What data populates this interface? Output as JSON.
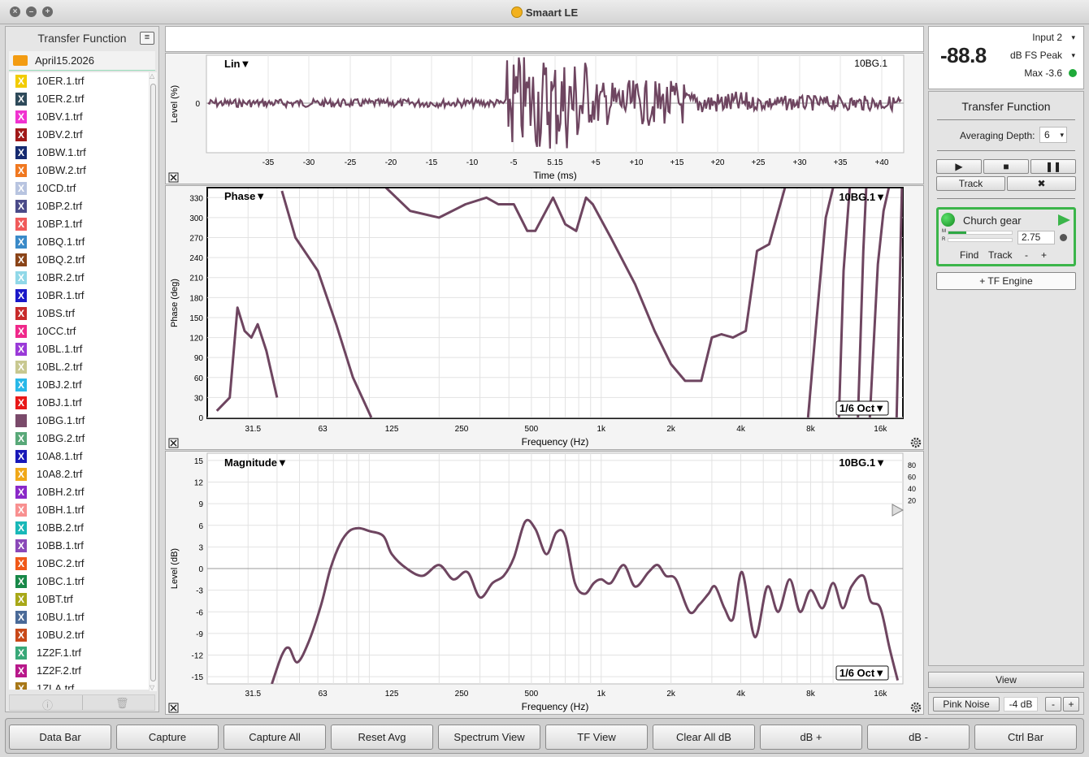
{
  "app": {
    "title": "Smaart LE"
  },
  "left_panel": {
    "title": "Transfer Function",
    "folder": "April15.2026",
    "files": [
      {
        "name": "10ER.1.trf",
        "color": "#f2cc00"
      },
      {
        "name": "10ER.2.trf",
        "color": "#2e4a5a"
      },
      {
        "name": "10BV.1.trf",
        "color": "#f032d0"
      },
      {
        "name": "10BV.2.trf",
        "color": "#a01818"
      },
      {
        "name": "10BW.1.trf",
        "color": "#152a70"
      },
      {
        "name": "10BW.2.trf",
        "color": "#f07820"
      },
      {
        "name": "10CD.trf",
        "color": "#b8c4e0"
      },
      {
        "name": "10BP.2.trf",
        "color": "#4a4a88"
      },
      {
        "name": "10BP.1.trf",
        "color": "#f05a5a"
      },
      {
        "name": "10BQ.1.trf",
        "color": "#3a8ac8"
      },
      {
        "name": "10BQ.2.trf",
        "color": "#8a4418"
      },
      {
        "name": "10BR.2.trf",
        "color": "#90d8e8"
      },
      {
        "name": "10BR.1.trf",
        "color": "#1a18c8"
      },
      {
        "name": "10BS.trf",
        "color": "#c82a2a"
      },
      {
        "name": "10CC.trf",
        "color": "#f0288a"
      },
      {
        "name": "10BL.1.trf",
        "color": "#9a3ad8"
      },
      {
        "name": "10BL.2.trf",
        "color": "#c8c890"
      },
      {
        "name": "10BJ.2.trf",
        "color": "#28b8e8"
      },
      {
        "name": "10BJ.1.trf",
        "color": "#e81818"
      },
      {
        "name": "10BG.1.trf",
        "color": "#7a4a6a"
      },
      {
        "name": "10BG.2.trf",
        "color": "#58a878"
      },
      {
        "name": "10A8.1.trf",
        "color": "#1818b8"
      },
      {
        "name": "10A8.2.trf",
        "color": "#f0a818"
      },
      {
        "name": "10BH.2.trf",
        "color": "#8a28c8"
      },
      {
        "name": "10BH.1.trf",
        "color": "#f89090"
      },
      {
        "name": "10BB.2.trf",
        "color": "#18b8b8"
      },
      {
        "name": "10BB.1.trf",
        "color": "#8a48b8"
      },
      {
        "name": "10BC.2.trf",
        "color": "#f05818"
      },
      {
        "name": "10BC.1.trf",
        "color": "#188848"
      },
      {
        "name": "10BT.trf",
        "color": "#a8a818"
      },
      {
        "name": "10BU.1.trf",
        "color": "#4a6a98"
      },
      {
        "name": "10BU.2.trf",
        "color": "#c84818"
      },
      {
        "name": "1Z2F.1.trf",
        "color": "#38a878"
      },
      {
        "name": "1Z2F.2.trf",
        "color": "#b8188a"
      },
      {
        "name": "1ZLA.trf",
        "color": "#a87818"
      }
    ]
  },
  "meter": {
    "value": "-88.8",
    "input": "Input 2",
    "mode": "dB FS Peak",
    "max": "Max -3.6"
  },
  "tf_panel": {
    "title": "Transfer Function",
    "averaging_label": "Averaging Depth:",
    "averaging_value": "6",
    "track_label": "Track",
    "engine": {
      "name": "Church gear",
      "value": "2.75",
      "find": "Find",
      "track": "Track",
      "minus": "-",
      "plus": "+",
      "m": "M",
      "r": "R"
    },
    "add_engine": "+ TF Engine"
  },
  "view_panel": {
    "view_label": "View",
    "pink_noise": "Pink Noise",
    "level": "-4 dB",
    "minus": "-",
    "plus": "+"
  },
  "toolbar": [
    "Data Bar",
    "Capture",
    "Capture All",
    "Reset Avg",
    "Spectrum View",
    "TF View",
    "Clear All dB",
    "dB +",
    "dB -",
    "Ctrl Bar"
  ],
  "impulse": {
    "label": "Lin▼",
    "trace": "10BG.1",
    "ylabel": "Level (%)",
    "xlabel": "Time (ms)",
    "zero_label": "0",
    "x_ticks": [
      "-35",
      "-30",
      "-25",
      "-20",
      "-15",
      "-10",
      "-5",
      "5.15",
      "+5",
      "+10",
      "+15",
      "+20",
      "+25",
      "+30",
      "+35",
      "+40"
    ]
  },
  "chart_data": [
    {
      "type": "line",
      "title": "Phase▼",
      "trace": "10BG.1▼",
      "ylabel": "Phase (deg)",
      "xlabel": "Frequency (Hz)",
      "smoothing": "1/6 Oct▼",
      "ylim": [
        0,
        345
      ],
      "y_ticks": [
        "330",
        "300",
        "270",
        "240",
        "210",
        "180",
        "150",
        "120",
        "90",
        "60",
        "30",
        "0"
      ],
      "x_ticks": [
        "31.5",
        "63",
        "125",
        "250",
        "500",
        "1k",
        "2k",
        "4k",
        "8k",
        "16k"
      ],
      "series": [
        {
          "color": "#6e4560",
          "segments": [
            [
              [
                22,
                10
              ],
              [
                25,
                30
              ],
              [
                27,
                165
              ],
              [
                29,
                130
              ],
              [
                31,
                120
              ],
              [
                33,
                140
              ],
              [
                36,
                100
              ],
              [
                40,
                30
              ]
            ],
            [
              [
                42,
                340
              ],
              [
                48,
                270
              ],
              [
                60,
                220
              ],
              [
                72,
                140
              ],
              [
                85,
                60
              ],
              [
                102,
                0
              ]
            ],
            [
              [
                118,
                345
              ],
              [
                150,
                310
              ],
              [
                200,
                300
              ],
              [
                260,
                320
              ],
              [
                320,
                330
              ],
              [
                360,
                320
              ],
              [
                420,
                320
              ],
              [
                480,
                280
              ],
              [
                520,
                280
              ],
              [
                620,
                330
              ],
              [
                700,
                290
              ],
              [
                780,
                280
              ],
              [
                860,
                330
              ],
              [
                920,
                320
              ],
              [
                1100,
                270
              ],
              [
                1400,
                200
              ],
              [
                1700,
                130
              ],
              [
                2000,
                80
              ],
              [
                2300,
                55
              ],
              [
                2700,
                55
              ],
              [
                3000,
                120
              ],
              [
                3300,
                125
              ],
              [
                3700,
                120
              ],
              [
                4200,
                130
              ],
              [
                4700,
                250
              ],
              [
                5300,
                260
              ],
              [
                6200,
                345
              ]
            ],
            [
              [
                7800,
                0
              ],
              [
                8500,
                150
              ],
              [
                9300,
                300
              ],
              [
                10000,
                345
              ]
            ],
            [
              [
                10600,
                0
              ],
              [
                11100,
                220
              ],
              [
                11800,
                345
              ]
            ],
            [
              [
                12800,
                0
              ],
              [
                13500,
                250
              ],
              [
                13900,
                345
              ]
            ],
            [
              [
                14400,
                0
              ],
              [
                15600,
                230
              ],
              [
                16500,
                310
              ],
              [
                17400,
                345
              ]
            ],
            [
              [
                18800,
                0
              ],
              [
                19800,
                345
              ]
            ]
          ]
        }
      ]
    },
    {
      "type": "line",
      "title": "Magnitude▼",
      "trace": "10BG.1▼",
      "ylabel": "Level (dB)",
      "xlabel": "Frequency (Hz)",
      "smoothing": "1/6 Oct▼",
      "ylim": [
        -16,
        16
      ],
      "y_ticks": [
        "15",
        "12",
        "9",
        "6",
        "3",
        "0",
        "-3",
        "-6",
        "-9",
        "-12",
        "-15"
      ],
      "x_ticks": [
        "31.5",
        "63",
        "125",
        "250",
        "500",
        "1k",
        "2k",
        "4k",
        "8k",
        "16k"
      ],
      "coherence_ticks": [
        "80",
        "60",
        "40",
        "20"
      ],
      "series": [
        {
          "color": "#6e4560",
          "values": [
            [
              38,
              -16
            ],
            [
              42,
              -12
            ],
            [
              45,
              -11
            ],
            [
              49,
              -13
            ],
            [
              55,
              -10
            ],
            [
              62,
              -5
            ],
            [
              68,
              0
            ],
            [
              75,
              3.5
            ],
            [
              82,
              5.2
            ],
            [
              90,
              5.6
            ],
            [
              100,
              5.2
            ],
            [
              115,
              4.5
            ],
            [
              125,
              2
            ],
            [
              145,
              0
            ],
            [
              170,
              -1
            ],
            [
              200,
              0.5
            ],
            [
              230,
              -1.5
            ],
            [
              265,
              -0.5
            ],
            [
              300,
              -4
            ],
            [
              340,
              -2
            ],
            [
              380,
              -1
            ],
            [
              420,
              1.5
            ],
            [
              470,
              6.5
            ],
            [
              520,
              5.5
            ],
            [
              580,
              2
            ],
            [
              640,
              5
            ],
            [
              700,
              4.5
            ],
            [
              770,
              -2
            ],
            [
              850,
              -3.5
            ],
            [
              930,
              -2
            ],
            [
              1000,
              -1.5
            ],
            [
              1100,
              -2
            ],
            [
              1250,
              0.5
            ],
            [
              1400,
              -2.5
            ],
            [
              1600,
              -0.5
            ],
            [
              1750,
              0.5
            ],
            [
              1900,
              -1
            ],
            [
              2100,
              -1.5
            ],
            [
              2400,
              -6
            ],
            [
              2650,
              -5
            ],
            [
              2900,
              -3.5
            ],
            [
              3100,
              -2.5
            ],
            [
              3400,
              -5.5
            ],
            [
              3700,
              -7
            ],
            [
              4050,
              -0.5
            ],
            [
              4600,
              -9.5
            ],
            [
              5200,
              -2.5
            ],
            [
              5800,
              -6
            ],
            [
              6500,
              -1.5
            ],
            [
              7200,
              -6
            ],
            [
              8000,
              -3
            ],
            [
              9000,
              -5.5
            ],
            [
              10000,
              -2
            ],
            [
              11000,
              -5.5
            ],
            [
              12000,
              -2.5
            ],
            [
              13500,
              -1
            ],
            [
              14500,
              -4.5
            ],
            [
              16000,
              -5.5
            ],
            [
              17500,
              -11
            ],
            [
              19000,
              -15.5
            ]
          ]
        }
      ]
    }
  ]
}
